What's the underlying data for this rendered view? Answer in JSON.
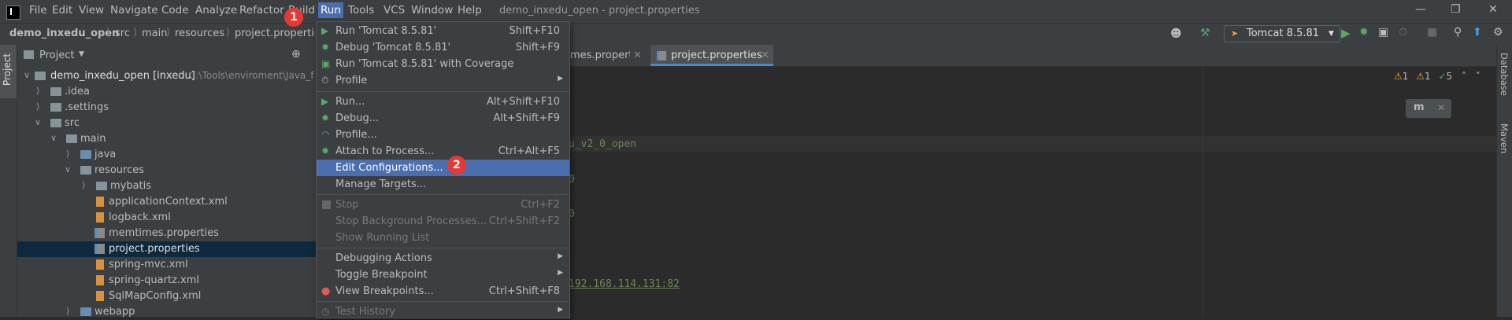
{
  "menubar": {
    "items": [
      "File",
      "Edit",
      "View",
      "Navigate",
      "Code",
      "Analyze",
      "Refactor",
      "Build",
      "Run",
      "Tools",
      "VCS",
      "Window",
      "Help"
    ],
    "window_title": "demo_inxedu_open - project.properties"
  },
  "breadcrumb": [
    "demo_inxedu_open",
    "src",
    "main",
    "resources",
    "project.properties"
  ],
  "toolbar": {
    "run_config": "Tomcat 8.5.81"
  },
  "sidebar": {
    "project_tab": "Project"
  },
  "project_panel": {
    "title": "Project",
    "rows": [
      {
        "label": "demo_inxedu_open [inxedu]",
        "note": "C:\\Tools\\enviroment\\Java_f"
      },
      {
        "label": ".idea"
      },
      {
        "label": ".settings"
      },
      {
        "label": "src"
      },
      {
        "label": "main"
      },
      {
        "label": "java"
      },
      {
        "label": "resources"
      },
      {
        "label": "mybatis"
      },
      {
        "label": "applicationContext.xml"
      },
      {
        "label": "logback.xml"
      },
      {
        "label": "memtimes.properties"
      },
      {
        "label": "project.properties"
      },
      {
        "label": "spring-mvc.xml"
      },
      {
        "label": "spring-quartz.xml"
      },
      {
        "label": "SqlMapConfig.xml"
      },
      {
        "label": "webapp"
      }
    ]
  },
  "editor": {
    "tabs": [
      "mes.properties",
      "project.properties"
    ],
    "code_fragments": [
      "u_v2_0_open",
      "0",
      "0",
      "192.168.114.131:82"
    ],
    "inspections": {
      "warn1": "1",
      "warn2": "1",
      "ok": "5"
    }
  },
  "right_stripe": {
    "labels": [
      "Database",
      "Maven"
    ]
  },
  "run_menu": {
    "items": [
      {
        "label": "Run 'Tomcat 8.5.81'",
        "shortcut": "Shift+F10"
      },
      {
        "label": "Debug 'Tomcat 8.5.81'",
        "shortcut": "Shift+F9"
      },
      {
        "label": "Run 'Tomcat 8.5.81' with Coverage",
        "shortcut": ""
      },
      {
        "label": "Profile",
        "shortcut": ""
      },
      {
        "label": "Run...",
        "shortcut": "Alt+Shift+F10"
      },
      {
        "label": "Debug...",
        "shortcut": "Alt+Shift+F9"
      },
      {
        "label": "Profile...",
        "shortcut": ""
      },
      {
        "label": "Attach to Process...",
        "shortcut": "Ctrl+Alt+F5"
      },
      {
        "label": "Edit Configurations...",
        "shortcut": ""
      },
      {
        "label": "Manage Targets...",
        "shortcut": ""
      },
      {
        "label": "Stop",
        "shortcut": "Ctrl+F2"
      },
      {
        "label": "Stop Background Processes...",
        "shortcut": "Ctrl+Shift+F2"
      },
      {
        "label": "Show Running List",
        "shortcut": ""
      },
      {
        "label": "Debugging Actions",
        "shortcut": ""
      },
      {
        "label": "Toggle Breakpoint",
        "shortcut": ""
      },
      {
        "label": "View Breakpoints...",
        "shortcut": "Ctrl+Shift+F8"
      },
      {
        "label": "Test History",
        "shortcut": ""
      }
    ]
  },
  "annotations": {
    "step1": "1",
    "step2": "2"
  },
  "colors": {
    "accent": "#4b6eaf",
    "badge": "#e53935",
    "selection": "#0d293e"
  }
}
